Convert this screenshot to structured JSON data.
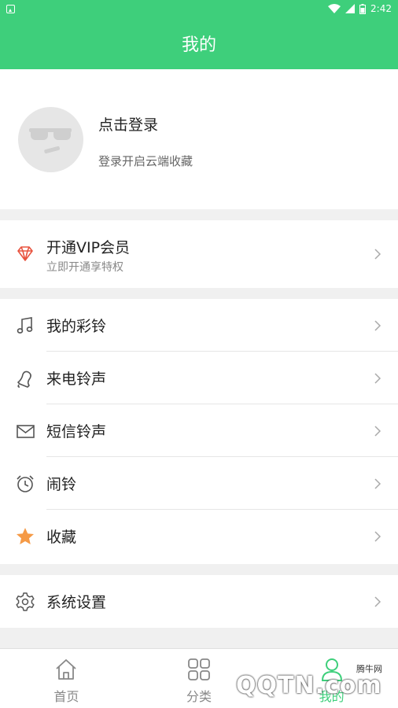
{
  "status_bar": {
    "time": "2:42"
  },
  "header": {
    "title": "我的"
  },
  "profile": {
    "login_label": "点击登录",
    "login_hint": "登录开启云端收藏"
  },
  "vip": {
    "label": "开通VIP会员",
    "sub": "立即开通享特权",
    "icon": "diamond-icon",
    "icon_color": "#e8533f"
  },
  "menu": [
    {
      "label": "我的彩铃",
      "icon": "music-note-icon"
    },
    {
      "label": "来电铃声",
      "icon": "bell-icon"
    },
    {
      "label": "短信铃声",
      "icon": "envelope-icon"
    },
    {
      "label": "闹铃",
      "icon": "alarm-clock-icon"
    },
    {
      "label": "收藏",
      "icon": "star-icon",
      "icon_color": "#f59a46"
    }
  ],
  "settings": {
    "label": "系统设置",
    "icon": "gear-icon"
  },
  "bottom_nav": [
    {
      "label": "首页",
      "icon": "home-icon",
      "active": false
    },
    {
      "label": "分类",
      "icon": "grid-icon",
      "active": false
    },
    {
      "label": "我的",
      "icon": "user-icon",
      "active": true
    }
  ],
  "watermark": {
    "text": "QQTN.com",
    "small": "腾牛网"
  },
  "colors": {
    "accent": "#3ecf7b",
    "background": "#f0f0f0"
  }
}
